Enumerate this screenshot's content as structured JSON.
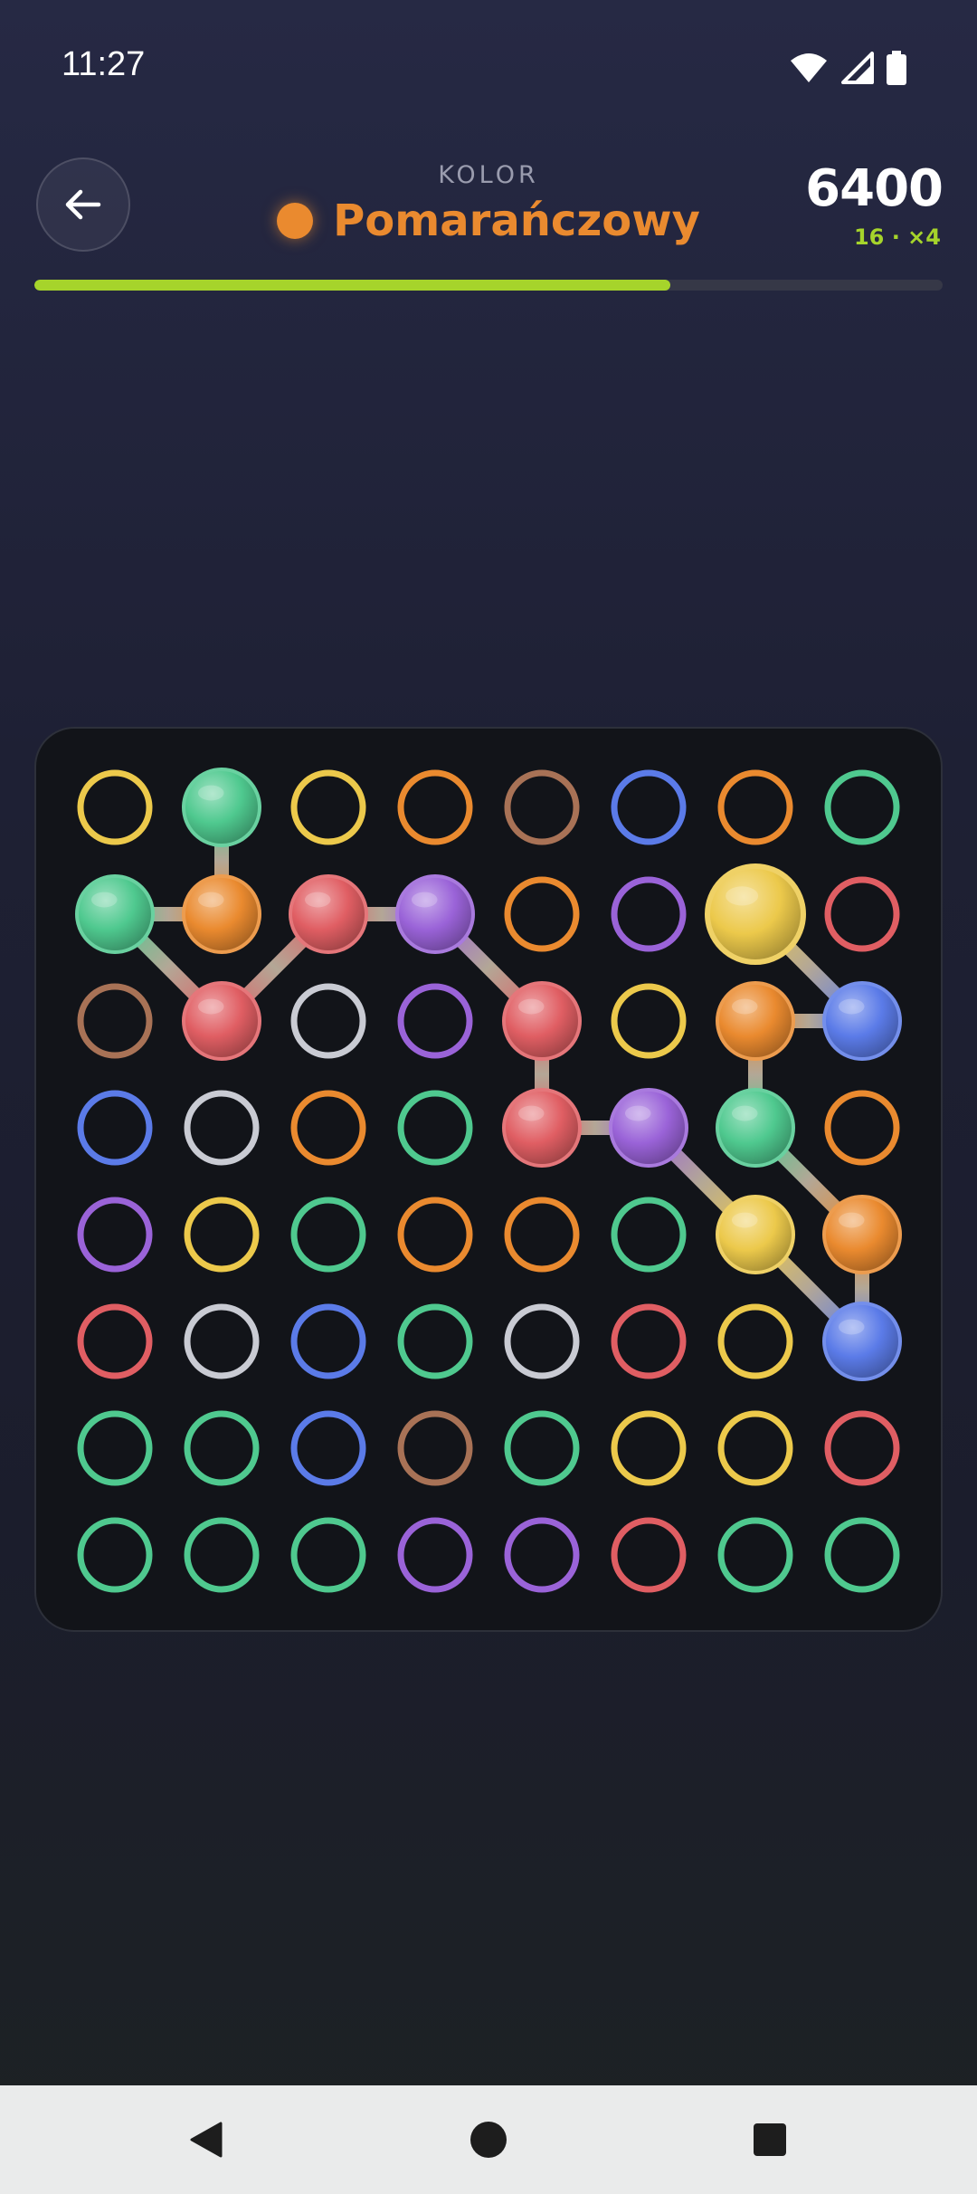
{
  "status_bar": {
    "time": "11:27",
    "icons": [
      "wifi-icon",
      "cell-signal-icon",
      "battery-icon"
    ]
  },
  "header": {
    "back_icon": "arrow-left-icon",
    "label": "KOLOR",
    "target_color_name": "Pomarańczowy",
    "target_color": "#ea8a2f",
    "score": "6400",
    "combo": "16 · ×4",
    "progress": 0.7
  },
  "palette": {
    "Y": "#ecc94b",
    "G": "#4fc98f",
    "O": "#ea8a2f",
    "B": "#a87256",
    "U": "#5b7be8",
    "R": "#e05e63",
    "P": "#9a63d8",
    "W": "#c9cbd3"
  },
  "board": {
    "rows": 8,
    "cols": 8,
    "grid": [
      [
        "Y",
        "G",
        "Y",
        "O",
        "B",
        "U",
        "O",
        "G"
      ],
      [
        "G",
        "O",
        "R",
        "P",
        "O",
        "P",
        "Y",
        "R"
      ],
      [
        "B",
        "R",
        "W",
        "P",
        "R",
        "Y",
        "O",
        "U"
      ],
      [
        "U",
        "W",
        "O",
        "G",
        "R",
        "P",
        "G",
        "O"
      ],
      [
        "P",
        "Y",
        "G",
        "O",
        "O",
        "G",
        "Y",
        "O"
      ],
      [
        "R",
        "W",
        "U",
        "G",
        "W",
        "R",
        "Y",
        "U"
      ],
      [
        "G",
        "G",
        "U",
        "B",
        "G",
        "Y",
        "Y",
        "R"
      ],
      [
        "G",
        "G",
        "G",
        "P",
        "P",
        "R",
        "G",
        "G"
      ]
    ],
    "chain": [
      [
        0,
        1
      ],
      [
        1,
        1
      ],
      [
        1,
        0
      ],
      [
        2,
        1
      ],
      [
        1,
        2
      ],
      [
        1,
        3
      ],
      [
        2,
        4
      ],
      [
        3,
        4
      ],
      [
        3,
        5
      ],
      [
        4,
        6
      ],
      [
        5,
        7
      ],
      [
        4,
        7
      ],
      [
        3,
        6
      ],
      [
        2,
        6
      ],
      [
        2,
        7
      ],
      [
        1,
        6
      ]
    ],
    "head": [
      1,
      6
    ]
  },
  "nav": {
    "items": [
      "back-nav-icon",
      "home-nav-icon",
      "recents-nav-icon"
    ]
  }
}
